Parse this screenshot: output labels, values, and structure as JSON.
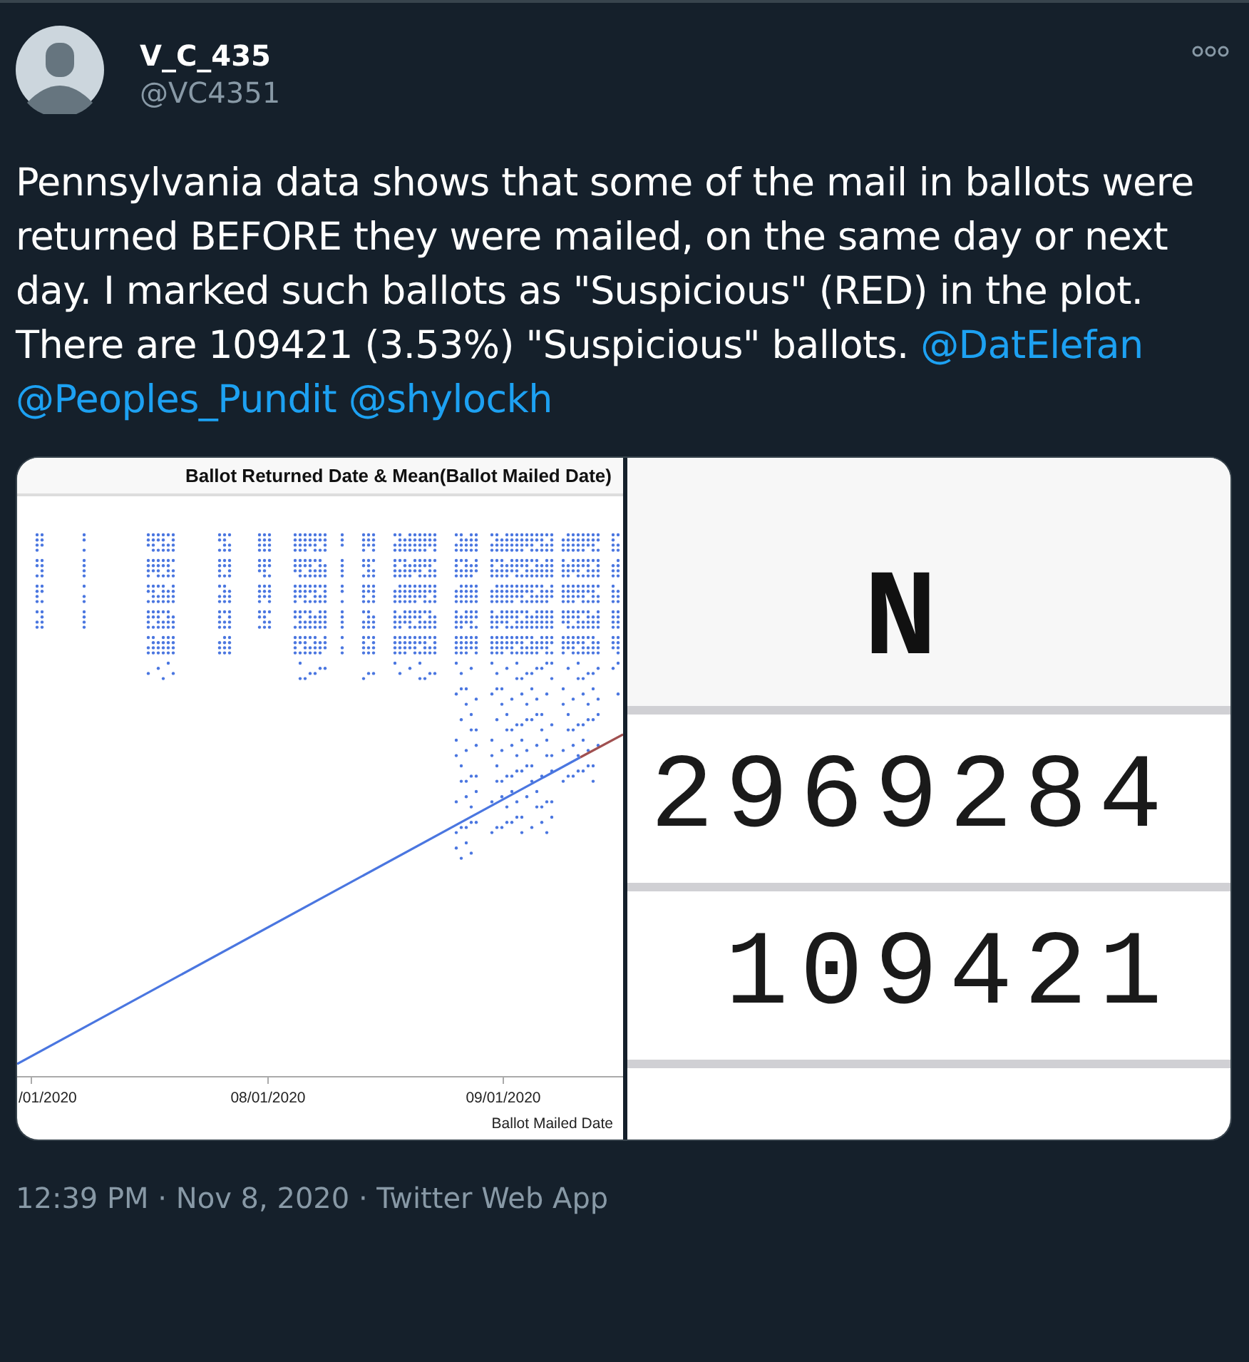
{
  "tweet": {
    "author": {
      "name": "V_C_435",
      "handle": "@VC4351"
    },
    "text": "Pennsylvania data shows that some of the mail in ballots were returned BEFORE they were mailed, on the same day or next day. I marked such ballots as \"Suspicious\" (RED) in the plot. There are 109421 (3.53%) \"Suspicious\" ballots.",
    "mentions": [
      "@DatElefan",
      "@Peoples_Pundit",
      "@shylockh"
    ],
    "media": [
      {
        "kind": "plot",
        "title": "Ballot Returned Date & Mean(Ballot Mailed Date)",
        "xticks": [
          "/01/2020",
          "08/01/2020",
          "09/01/2020"
        ],
        "xlabel": "Ballot Mailed Date"
      },
      {
        "kind": "table",
        "header": "N",
        "rows": [
          "2969284",
          "109421"
        ]
      }
    ],
    "footer": "12:39 PM · Nov 8, 2020 · Twitter Web App"
  }
}
